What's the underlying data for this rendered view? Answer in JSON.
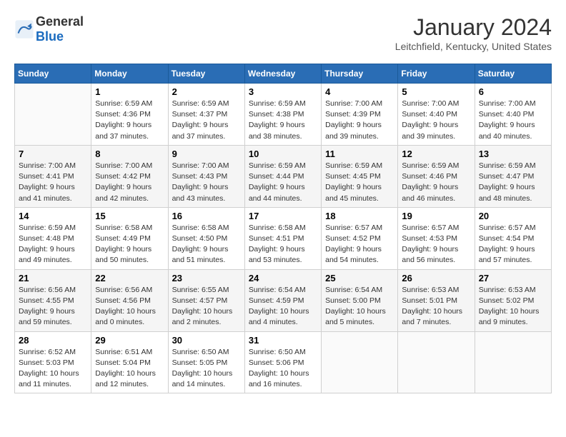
{
  "header": {
    "logo": {
      "general": "General",
      "blue": "Blue"
    },
    "title": "January 2024",
    "location": "Leitchfield, Kentucky, United States"
  },
  "calendar": {
    "days_of_week": [
      "Sunday",
      "Monday",
      "Tuesday",
      "Wednesday",
      "Thursday",
      "Friday",
      "Saturday"
    ],
    "weeks": [
      [
        {
          "day": "",
          "info": ""
        },
        {
          "day": "1",
          "info": "Sunrise: 6:59 AM\nSunset: 4:36 PM\nDaylight: 9 hours\nand 37 minutes."
        },
        {
          "day": "2",
          "info": "Sunrise: 6:59 AM\nSunset: 4:37 PM\nDaylight: 9 hours\nand 37 minutes."
        },
        {
          "day": "3",
          "info": "Sunrise: 6:59 AM\nSunset: 4:38 PM\nDaylight: 9 hours\nand 38 minutes."
        },
        {
          "day": "4",
          "info": "Sunrise: 7:00 AM\nSunset: 4:39 PM\nDaylight: 9 hours\nand 39 minutes."
        },
        {
          "day": "5",
          "info": "Sunrise: 7:00 AM\nSunset: 4:40 PM\nDaylight: 9 hours\nand 39 minutes."
        },
        {
          "day": "6",
          "info": "Sunrise: 7:00 AM\nSunset: 4:40 PM\nDaylight: 9 hours\nand 40 minutes."
        }
      ],
      [
        {
          "day": "7",
          "info": "Sunrise: 7:00 AM\nSunset: 4:41 PM\nDaylight: 9 hours\nand 41 minutes."
        },
        {
          "day": "8",
          "info": "Sunrise: 7:00 AM\nSunset: 4:42 PM\nDaylight: 9 hours\nand 42 minutes."
        },
        {
          "day": "9",
          "info": "Sunrise: 7:00 AM\nSunset: 4:43 PM\nDaylight: 9 hours\nand 43 minutes."
        },
        {
          "day": "10",
          "info": "Sunrise: 6:59 AM\nSunset: 4:44 PM\nDaylight: 9 hours\nand 44 minutes."
        },
        {
          "day": "11",
          "info": "Sunrise: 6:59 AM\nSunset: 4:45 PM\nDaylight: 9 hours\nand 45 minutes."
        },
        {
          "day": "12",
          "info": "Sunrise: 6:59 AM\nSunset: 4:46 PM\nDaylight: 9 hours\nand 46 minutes."
        },
        {
          "day": "13",
          "info": "Sunrise: 6:59 AM\nSunset: 4:47 PM\nDaylight: 9 hours\nand 48 minutes."
        }
      ],
      [
        {
          "day": "14",
          "info": "Sunrise: 6:59 AM\nSunset: 4:48 PM\nDaylight: 9 hours\nand 49 minutes."
        },
        {
          "day": "15",
          "info": "Sunrise: 6:58 AM\nSunset: 4:49 PM\nDaylight: 9 hours\nand 50 minutes."
        },
        {
          "day": "16",
          "info": "Sunrise: 6:58 AM\nSunset: 4:50 PM\nDaylight: 9 hours\nand 51 minutes."
        },
        {
          "day": "17",
          "info": "Sunrise: 6:58 AM\nSunset: 4:51 PM\nDaylight: 9 hours\nand 53 minutes."
        },
        {
          "day": "18",
          "info": "Sunrise: 6:57 AM\nSunset: 4:52 PM\nDaylight: 9 hours\nand 54 minutes."
        },
        {
          "day": "19",
          "info": "Sunrise: 6:57 AM\nSunset: 4:53 PM\nDaylight: 9 hours\nand 56 minutes."
        },
        {
          "day": "20",
          "info": "Sunrise: 6:57 AM\nSunset: 4:54 PM\nDaylight: 9 hours\nand 57 minutes."
        }
      ],
      [
        {
          "day": "21",
          "info": "Sunrise: 6:56 AM\nSunset: 4:55 PM\nDaylight: 9 hours\nand 59 minutes."
        },
        {
          "day": "22",
          "info": "Sunrise: 6:56 AM\nSunset: 4:56 PM\nDaylight: 10 hours\nand 0 minutes."
        },
        {
          "day": "23",
          "info": "Sunrise: 6:55 AM\nSunset: 4:57 PM\nDaylight: 10 hours\nand 2 minutes."
        },
        {
          "day": "24",
          "info": "Sunrise: 6:54 AM\nSunset: 4:59 PM\nDaylight: 10 hours\nand 4 minutes."
        },
        {
          "day": "25",
          "info": "Sunrise: 6:54 AM\nSunset: 5:00 PM\nDaylight: 10 hours\nand 5 minutes."
        },
        {
          "day": "26",
          "info": "Sunrise: 6:53 AM\nSunset: 5:01 PM\nDaylight: 10 hours\nand 7 minutes."
        },
        {
          "day": "27",
          "info": "Sunrise: 6:53 AM\nSunset: 5:02 PM\nDaylight: 10 hours\nand 9 minutes."
        }
      ],
      [
        {
          "day": "28",
          "info": "Sunrise: 6:52 AM\nSunset: 5:03 PM\nDaylight: 10 hours\nand 11 minutes."
        },
        {
          "day": "29",
          "info": "Sunrise: 6:51 AM\nSunset: 5:04 PM\nDaylight: 10 hours\nand 12 minutes."
        },
        {
          "day": "30",
          "info": "Sunrise: 6:50 AM\nSunset: 5:05 PM\nDaylight: 10 hours\nand 14 minutes."
        },
        {
          "day": "31",
          "info": "Sunrise: 6:50 AM\nSunset: 5:06 PM\nDaylight: 10 hours\nand 16 minutes."
        },
        {
          "day": "",
          "info": ""
        },
        {
          "day": "",
          "info": ""
        },
        {
          "day": "",
          "info": ""
        }
      ]
    ]
  }
}
